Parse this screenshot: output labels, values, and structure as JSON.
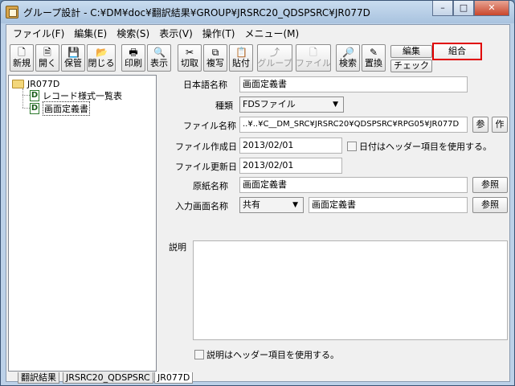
{
  "window": {
    "title": "グループ設計 - C:¥DM¥doc¥翻訳結果¥GROUP¥JRSRC20_QDSPSRC¥JR077D",
    "controls": {
      "minimize": "–",
      "maximize": "□",
      "close": "✕"
    }
  },
  "menu": {
    "items": [
      {
        "label": "ファイル(F)"
      },
      {
        "label": "編集(E)"
      },
      {
        "label": "検索(S)"
      },
      {
        "label": "表示(V)"
      },
      {
        "label": "操作(T)"
      },
      {
        "label": "メニュー(M)"
      }
    ]
  },
  "toolbar": {
    "new": "新規",
    "open": "開く",
    "save": "保管",
    "close": "閉じる",
    "print": "印刷",
    "view": "表示",
    "cut": "切取",
    "copy": "複写",
    "paste": "貼付",
    "group": "グループ",
    "file": "ファイル",
    "search": "検索",
    "replace": "置換",
    "edit": "編集",
    "check": "チェック",
    "combine": "組合"
  },
  "tree": {
    "root": "JR077D",
    "items": [
      {
        "label": "レコード様式一覧表",
        "icon": "D"
      },
      {
        "label": "画面定義書",
        "icon": "D"
      }
    ]
  },
  "form": {
    "jp_name_label": "日本語名称",
    "jp_name_value": "画面定義書",
    "type_label": "種類",
    "type_value": "FDSファイル",
    "filename_label": "ファイル名称",
    "filename_value": "..¥..¥C__DM_SRC¥JRSRC20¥QDSPSRC¥RPG05¥JR077D",
    "ref_short": "参",
    "create_short": "作",
    "created_label": "ファイル作成日",
    "created_value": "2013/02/01",
    "header_date_check": "日付はヘッダー項目を使用する。",
    "updated_label": "ファイル更新日",
    "updated_value": "2013/02/01",
    "original_label": "原紙名称",
    "original_value": "画面定義書",
    "ref_button": "参照",
    "input_screen_label": "入力画面名称",
    "input_screen_select": "共有",
    "input_screen_value": "画面定義書",
    "ref_button2": "参照",
    "desc_label": "説明",
    "desc_value": "",
    "desc_header_check": "説明はヘッダー項目を使用する。"
  },
  "tabs": [
    {
      "label": "翻訳結果"
    },
    {
      "label": "JRSRC20_QDSPSRC"
    },
    {
      "label": "JR077D"
    }
  ]
}
